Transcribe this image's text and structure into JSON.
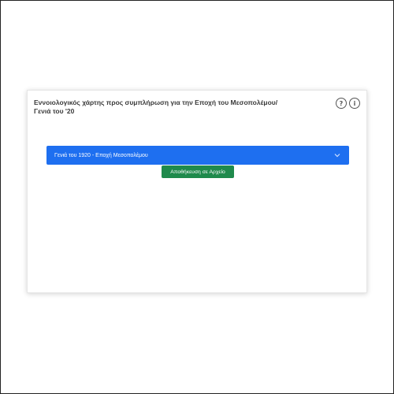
{
  "card": {
    "title": "Εννοιολογικός χάρτης προς συμπλήρωση για την Εποχή του Μεσοπολέμου/ Γενιά του '20",
    "help_icon_glyph": "?",
    "info_icon_glyph": "i"
  },
  "dropdown": {
    "selected": "Γενιά του 1920 - Εποχή Μεσοπολέμου",
    "color": "#1e6ff0"
  },
  "save_button": {
    "label": "Αποθήκευση σε Αρχείο",
    "color": "#1f8a4c"
  }
}
